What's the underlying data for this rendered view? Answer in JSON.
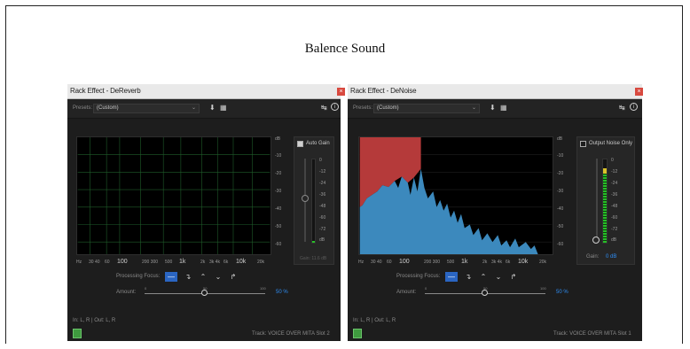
{
  "page_title": "Balence Sound",
  "left_panel": {
    "window_title": "Rack Effect - DeReverb",
    "presets_label": "Presets:",
    "presets_value": "(Custom)",
    "checkbox_label": "Auto Gain",
    "checkbox_checked": true,
    "db_scale": [
      "dB",
      "-10",
      "-20",
      "-30",
      "-40",
      "-50",
      "-60"
    ],
    "meter_scale": [
      "0",
      "-12",
      "-24",
      "-36",
      "-48",
      "-60",
      "-72",
      "dB"
    ],
    "freq_axis": [
      "Hz",
      "30 40",
      "60",
      "100",
      "200 300",
      "500",
      "1k",
      "2k",
      "3k 4k",
      "6k",
      "10k",
      "20k"
    ],
    "gain_label": "Gain: 11.6 dB",
    "processing_focus_label": "Processing Focus:",
    "amount_label": "Amount:",
    "amount_ticks": [
      "0",
      "50",
      "100"
    ],
    "amount_value": "50 %",
    "amount_fraction": 0.5,
    "io_text": "In: L, R | Out: L, R",
    "track_text": "Track: VOICE OVER MITA   Slot 2"
  },
  "right_panel": {
    "window_title": "Rack Effect - DeNoise",
    "presets_label": "Presets:",
    "presets_value": "(Custom)",
    "checkbox_label": "Output Noise Only",
    "checkbox_checked": false,
    "db_scale": [
      "dB",
      "-10",
      "-20",
      "-30",
      "-40",
      "-50",
      "-60"
    ],
    "meter_scale": [
      "0",
      "-12",
      "-24",
      "-36",
      "-48",
      "-60",
      "-72",
      "dB"
    ],
    "freq_axis": [
      "Hz",
      "30 40",
      "60",
      "100",
      "200 300",
      "500",
      "1k",
      "2k",
      "3k 4k",
      "6k",
      "10k",
      "20k"
    ],
    "gain_label": "Gain:",
    "gain_value": "0 dB",
    "processing_focus_label": "Processing Focus:",
    "amount_label": "Amount:",
    "amount_ticks": [
      "0",
      "50",
      "100"
    ],
    "amount_value": "50 %",
    "amount_fraction": 0.5,
    "io_text": "In: L, R | Out: L, R",
    "track_text": "Track: VOICE OVER MITA   Slot 1"
  },
  "colors": {
    "accent_blue": "#2e8ef5",
    "selected_focus": "#2a65c2",
    "grid_green": "#1f5c2a",
    "noise_red": "#b53a3a",
    "spectrum_blue": "#3c89bd",
    "power_green": "#3f9a3f",
    "close_red": "#d8493f"
  },
  "icons": {
    "close": "close-icon",
    "save": "save-preset-icon",
    "delete": "trash-icon",
    "route": "routing-icon",
    "info": "info-icon"
  }
}
